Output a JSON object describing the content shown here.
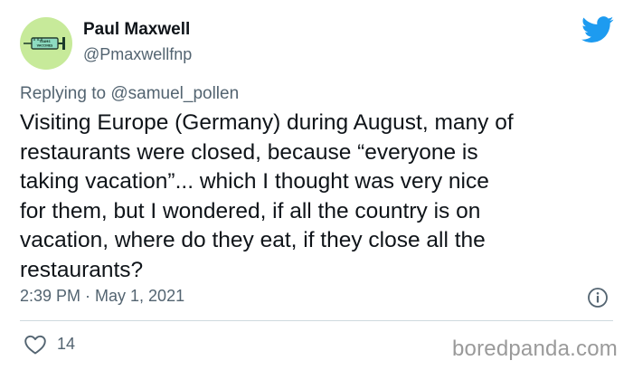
{
  "tweet": {
    "display_name": "Paul Maxwell",
    "handle": "@Pmaxwellfnp",
    "avatar_icon": "syringe-icon",
    "avatar_text": "TEAMS VACCINES",
    "replying_prefix": "Replying to",
    "replying_to": "@samuel_pollen",
    "text": "Visiting Europe (Germany) during August, many of\nrestaurants were closed, because “everyone is\ntaking vacation”... which I thought was very nice\nfor them, but I wondered, if all the country is on\nvacation, where do they eat, if they close all the\nrestaurants?",
    "timestamp": "2:39 PM · May 1, 2021",
    "like_count": "14"
  },
  "watermark": "boredpanda.com",
  "colors": {
    "twitter_blue": "#1d9bf0",
    "secondary_text": "#536471",
    "avatar_bg": "#c7ea9a"
  }
}
